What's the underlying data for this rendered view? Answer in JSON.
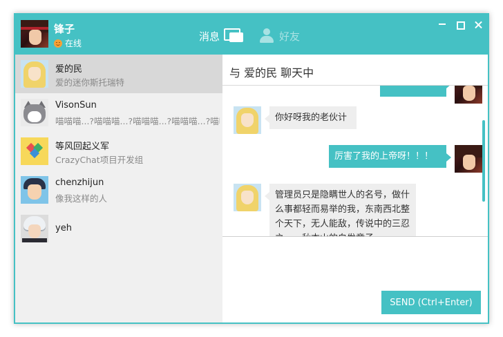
{
  "header": {
    "user_name": "锋子",
    "status": "在线",
    "nav_messages": "消息",
    "nav_friends": "好友"
  },
  "contacts": [
    {
      "name": "爱的民",
      "signature": "爱的迷你斯托瑞特",
      "avatar": "blonde-girl-avatar"
    },
    {
      "name": "VisonSun",
      "signature": "喵喵喵...?喵喵喵...?喵喵喵...?喵喵喵...?喵喵喵...?喵",
      "avatar": "cat-avatar"
    },
    {
      "name": "等风回起义军",
      "signature": "CrazyChat项目开发组",
      "avatar": "heart-group-avatar"
    },
    {
      "name": "chenzhijun",
      "signature": "像我这样的人",
      "avatar": "boy-avatar"
    },
    {
      "name": "yeh",
      "signature": "",
      "avatar": "silver-hair-avatar"
    }
  ],
  "chat": {
    "title": "与 爱的民 聊天中",
    "messages": [
      {
        "from": "other",
        "text": "你好呀我的老伙计"
      },
      {
        "from": "self",
        "text": "厉害了我的上帝呀！！！"
      },
      {
        "from": "other",
        "text": "管理员只是隐瞒世人的名号，做什么事都轻而易举的我，东南西北整个天下，无人能敌，传说中的三忍之一，秋本山的白发童子"
      }
    ],
    "send_label": "SEND (Ctrl+Enter)",
    "input_value": ""
  },
  "colors": {
    "accent": "#45c1c4",
    "sidebar_bg": "#f0f0f0",
    "active_contact": "#d8d8d8",
    "bubble_other": "#eeeeee"
  }
}
